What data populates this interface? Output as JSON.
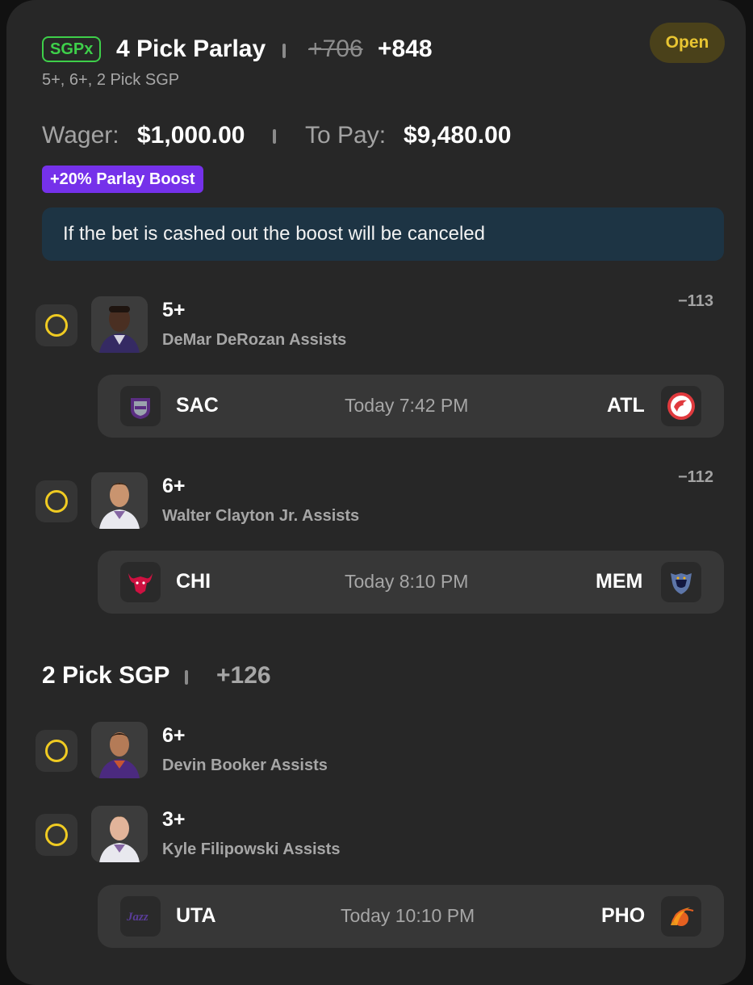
{
  "header": {
    "tag": "SGPx",
    "title": "4 Pick Parlay",
    "original_odds": "+706",
    "odds": "+848",
    "subtitle": "5+, 6+, 2 Pick SGP",
    "status": "Open"
  },
  "wager": {
    "wager_label": "Wager:",
    "wager_value": "$1,000.00",
    "topay_label": "To Pay:",
    "topay_value": "$9,480.00"
  },
  "boost": {
    "label": "+20% Parlay Boost",
    "notice": "If the bet is cashed out the boost will be canceled"
  },
  "picks": [
    {
      "value": "5+",
      "desc": "DeMar DeRozan Assists",
      "odds": "−113"
    },
    {
      "value": "6+",
      "desc": "Walter Clayton Jr. Assists",
      "odds": "−112"
    },
    {
      "value": "6+",
      "desc": "Devin Booker Assists",
      "odds": ""
    },
    {
      "value": "3+",
      "desc": "Kyle Filipowski Assists",
      "odds": ""
    }
  ],
  "games": [
    {
      "home": "SAC",
      "time": "Today 7:42 PM",
      "away": "ATL",
      "home_icon": "kings-logo-icon",
      "away_icon": "hawks-logo-icon"
    },
    {
      "home": "CHI",
      "time": "Today 8:10 PM",
      "away": "MEM",
      "home_icon": "bulls-logo-icon",
      "away_icon": "grizzlies-logo-icon"
    },
    {
      "home": "UTA",
      "time": "Today 10:10 PM",
      "away": "PHO",
      "home_icon": "jazz-logo-icon",
      "away_icon": "suns-logo-icon"
    }
  ],
  "sgp": {
    "title": "2 Pick SGP",
    "odds": "+126"
  },
  "colors": {
    "card": "#272727",
    "sgpx_green": "#3ecf4a",
    "open_yellow": "#e8c532",
    "boost_purple": "#7531ea",
    "notice_blue": "#1d3444",
    "check_ring": "#f0cb22"
  }
}
